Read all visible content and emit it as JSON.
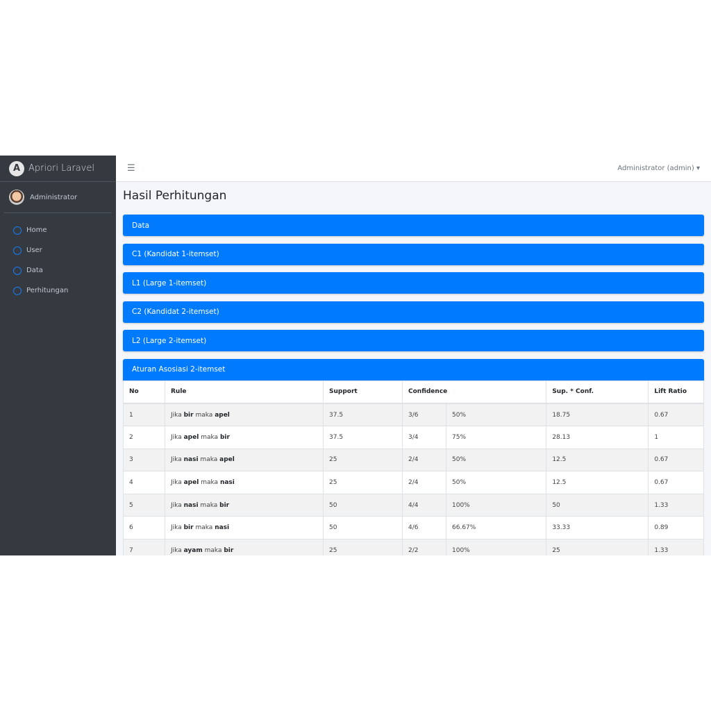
{
  "brand": "Apriori Laravel",
  "user": "Administrator",
  "nav": [
    {
      "label": "Home"
    },
    {
      "label": "User"
    },
    {
      "label": "Data"
    },
    {
      "label": "Perhitungan"
    }
  ],
  "topbar": {
    "user_menu": "Administrator (admin) ▾"
  },
  "page_title": "Hasil Perhitungan",
  "cards": [
    "Data",
    "C1 (Kandidat 1-itemset)",
    "L1 (Large 1-itemset)",
    "C2 (Kandidat 2-itemset)",
    "L2 (Large 2-itemset)",
    "Aturan Asosiasi 2-itemset"
  ],
  "table": {
    "headers": {
      "no": "No",
      "rule": "Rule",
      "support": "Support",
      "confidence": "Confidence",
      "supconf": "Sup. * Conf.",
      "lift": "Lift Ratio"
    },
    "if_word": "Jika",
    "then_word": "maka",
    "rows": [
      {
        "no": "1",
        "a": "bir",
        "b": "apel",
        "support": "37.5",
        "frac": "3/6",
        "pct": "50%",
        "supconf": "18.75",
        "lift": "0.67"
      },
      {
        "no": "2",
        "a": "apel",
        "b": "bir",
        "support": "37.5",
        "frac": "3/4",
        "pct": "75%",
        "supconf": "28.13",
        "lift": "1"
      },
      {
        "no": "3",
        "a": "nasi",
        "b": "apel",
        "support": "25",
        "frac": "2/4",
        "pct": "50%",
        "supconf": "12.5",
        "lift": "0.67"
      },
      {
        "no": "4",
        "a": "apel",
        "b": "nasi",
        "support": "25",
        "frac": "2/4",
        "pct": "50%",
        "supconf": "12.5",
        "lift": "0.67"
      },
      {
        "no": "5",
        "a": "nasi",
        "b": "bir",
        "support": "50",
        "frac": "4/4",
        "pct": "100%",
        "supconf": "50",
        "lift": "1.33"
      },
      {
        "no": "6",
        "a": "bir",
        "b": "nasi",
        "support": "50",
        "frac": "4/6",
        "pct": "66.67%",
        "supconf": "33.33",
        "lift": "0.89"
      },
      {
        "no": "7",
        "a": "ayam",
        "b": "bir",
        "support": "25",
        "frac": "2/2",
        "pct": "100%",
        "supconf": "25",
        "lift": "1.33"
      }
    ]
  }
}
